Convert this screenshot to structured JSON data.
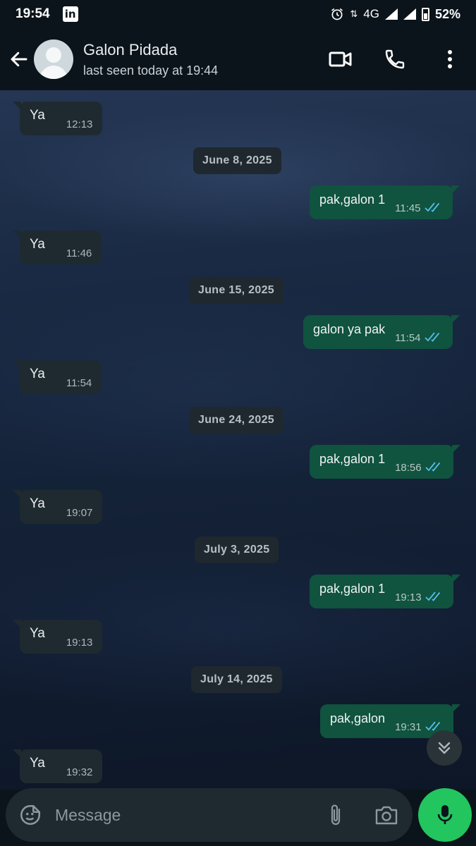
{
  "status_bar": {
    "time": "19:54",
    "app_icon": "in",
    "network": "4G",
    "battery": "52%"
  },
  "header": {
    "name": "Galon Pidada",
    "last_seen": "last seen today at 19:44"
  },
  "messages": [
    {
      "kind": "in",
      "text": "Ya",
      "time": "12:13"
    },
    {
      "kind": "date",
      "text": "June 8, 2025"
    },
    {
      "kind": "out",
      "text": "pak,galon 1",
      "time": "11:45"
    },
    {
      "kind": "in",
      "text": "Ya",
      "time": "11:46"
    },
    {
      "kind": "date",
      "text": "June 15, 2025"
    },
    {
      "kind": "out",
      "text": "galon ya pak",
      "time": "11:54"
    },
    {
      "kind": "in",
      "text": "Ya",
      "time": "11:54"
    },
    {
      "kind": "date",
      "text": "June 24, 2025"
    },
    {
      "kind": "out",
      "text": "pak,galon 1",
      "time": "18:56"
    },
    {
      "kind": "in",
      "text": "Ya",
      "time": "19:07"
    },
    {
      "kind": "date",
      "text": "July 3, 2025"
    },
    {
      "kind": "out",
      "text": "pak,galon 1",
      "time": "19:13"
    },
    {
      "kind": "in",
      "text": "Ya",
      "time": "19:13"
    },
    {
      "kind": "date",
      "text": "July 14, 2025"
    },
    {
      "kind": "out",
      "text": "pak,galon",
      "time": "19:31"
    },
    {
      "kind": "in",
      "text": "Ya",
      "time": "19:32"
    }
  ],
  "composer": {
    "placeholder": "Message"
  },
  "colors": {
    "accent_green": "#22c55e",
    "read_tick": "#53bdeb",
    "bubble_out": "#10533f",
    "bubble_in": "#1f2a30"
  }
}
